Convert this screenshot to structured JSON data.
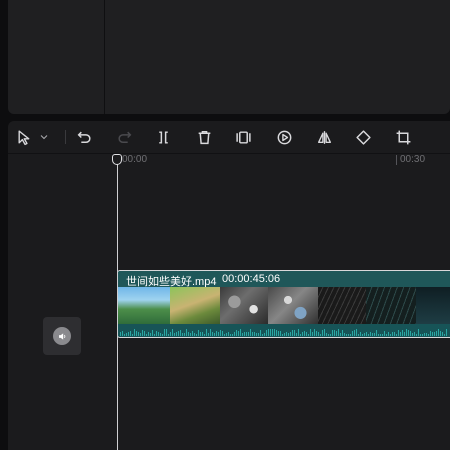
{
  "toolbar": {
    "tools": [
      {
        "icon": "select-arrow-icon"
      },
      {
        "icon": "chevron-down-icon"
      },
      {
        "icon": "undo-icon"
      },
      {
        "icon": "redo-icon",
        "disabled": true
      },
      {
        "icon": "split-icon"
      },
      {
        "icon": "delete-icon"
      },
      {
        "icon": "freeze-frame-icon"
      },
      {
        "icon": "speed-icon"
      },
      {
        "icon": "mirror-icon"
      },
      {
        "icon": "rotate-icon"
      },
      {
        "icon": "crop-icon"
      }
    ]
  },
  "ruler": {
    "ticks": [
      "00:00",
      "00:30"
    ]
  },
  "track": {
    "audio_toggle_icon": "speaker-icon"
  },
  "clip": {
    "name": "世间如些美好.mp4",
    "duration": "00:00:45:06",
    "color": "#1c5a5d"
  },
  "colors": {
    "background": "#0d0d0f",
    "panel": "#1b1b1d",
    "playhead": "#cfcfd2",
    "clip_waveform": "#2aa7a3"
  }
}
